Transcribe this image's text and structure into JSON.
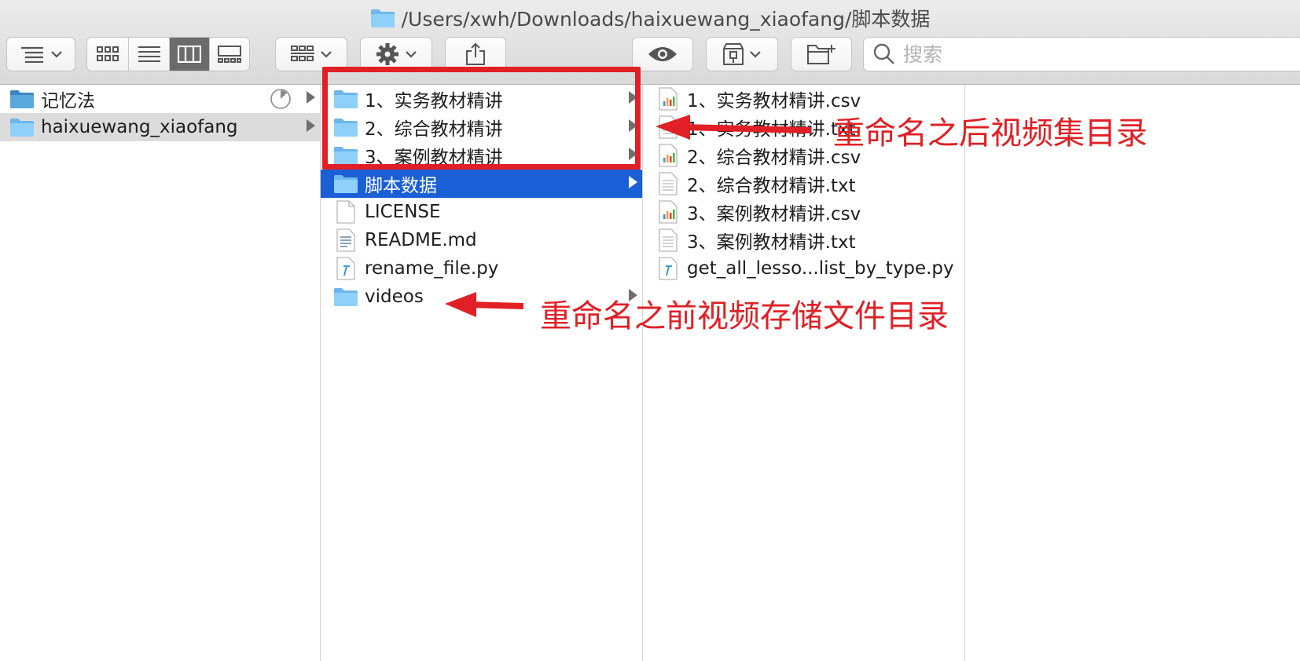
{
  "window": {
    "path_title": "/Users/xwh/Downloads/haixuewang_xiaofang/脚本数据"
  },
  "toolbar": {
    "icons": [
      "list-sort-icon",
      "icon-view-icon",
      "list-view-icon",
      "column-view-icon",
      "gallery-view-icon",
      "group-icon",
      "gear-icon",
      "share-icon",
      "eye-icon",
      "archive-icon",
      "new-folder-icon",
      "search-icon"
    ],
    "active_view": "column-view",
    "search_placeholder": "搜索"
  },
  "columns": {
    "col1": [
      {
        "label": "记忆法",
        "type": "folder",
        "spinner": true,
        "has_arrow": true,
        "selected": false
      },
      {
        "label": "haixuewang_xiaofang",
        "type": "folder",
        "has_arrow": true,
        "selected": "grey"
      }
    ],
    "col2": [
      {
        "label": "1、实务教材精讲",
        "type": "folder",
        "has_arrow": true
      },
      {
        "label": "2、综合教材精讲",
        "type": "folder",
        "has_arrow": true
      },
      {
        "label": "3、案例教材精讲",
        "type": "folder",
        "has_arrow": true
      },
      {
        "label": "脚本数据",
        "type": "folder",
        "has_arrow": true,
        "selected": "blue"
      },
      {
        "label": "LICENSE",
        "type": "file"
      },
      {
        "label": "README.md",
        "type": "text"
      },
      {
        "label": "rename_file.py",
        "type": "python"
      },
      {
        "label": "videos",
        "type": "folder",
        "has_arrow": true
      }
    ],
    "col3": [
      {
        "label": "1、实务教材精讲.csv",
        "type": "csv"
      },
      {
        "label": "1、实务教材精讲.txt",
        "type": "text"
      },
      {
        "label": "2、综合教材精讲.csv",
        "type": "csv"
      },
      {
        "label": "2、综合教材精讲.txt",
        "type": "text"
      },
      {
        "label": "3、案例教材精讲.csv",
        "type": "csv"
      },
      {
        "label": "3、案例教材精讲.txt",
        "type": "text"
      },
      {
        "label": "get_all_lesso...list_by_type.py",
        "type": "python"
      }
    ]
  },
  "annotations": {
    "after_rename": "重命名之后视频集目录",
    "before_rename": "重命名之前视频存储文件目录",
    "color": "#e02026"
  },
  "colors": {
    "selection_blue": "#1a5fd6",
    "selection_grey": "#dcdcdc",
    "folder_blue": "#6cb8ee"
  }
}
